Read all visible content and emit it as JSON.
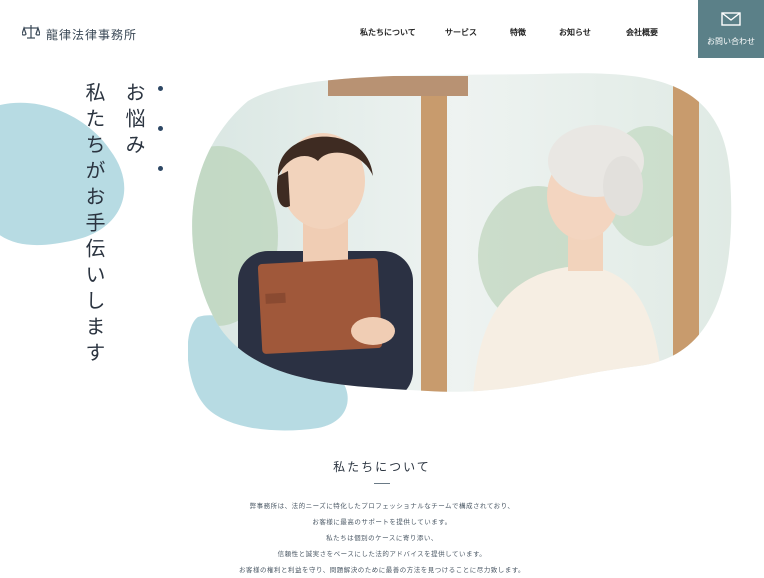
{
  "header": {
    "logo_icon": "scales-of-justice-icon",
    "logo_text": "龍律法律事務所",
    "nav": [
      "私たちについて",
      "サービス",
      "特徴",
      "お知らせ",
      "会社概要"
    ],
    "contact": {
      "icon": "mail-icon",
      "label": "お問い合わせ"
    }
  },
  "hero": {
    "line1": "お悩み",
    "line2": "私たちがお手伝いします"
  },
  "about": {
    "title": "私たちについて",
    "lines": [
      "弊事務所は、法的ニーズに特化したプロフェッショナルなチームで構成されており、",
      "お客様に最高のサポートを提供しています。",
      "私たちは個別のケースに寄り添い、",
      "信頼性と誠実さをベースにした法的アドバイスを提供しています。",
      "お客様の権利と利益を守り、問題解決のために最善の方法を見つけることに尽力致します。"
    ]
  },
  "colors": {
    "accent": "#5b8088",
    "blob": "#b7dbe3",
    "dots": "#2d4764"
  }
}
